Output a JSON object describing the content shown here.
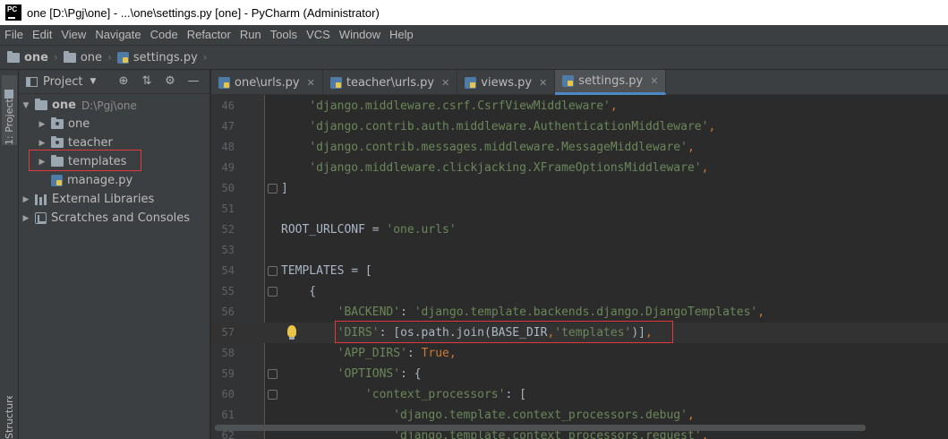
{
  "title": "one [D:\\Pgj\\one] - ...\\one\\settings.py [one] - PyCharm (Administrator)",
  "app_icon_text": "PC",
  "menu": [
    "File",
    "Edit",
    "View",
    "Navigate",
    "Code",
    "Refactor",
    "Run",
    "Tools",
    "VCS",
    "Window",
    "Help"
  ],
  "breadcrumb": [
    "one",
    "one",
    "settings.py"
  ],
  "toolstrip": {
    "project_tab": "1: Project",
    "structure_tab": "Structure"
  },
  "project_panel": {
    "title": "Project",
    "tree": [
      {
        "label": "one",
        "hint": "D:\\Pgj\\one",
        "level": 0,
        "expanded": true,
        "kind": "folder"
      },
      {
        "label": "one",
        "level": 1,
        "expanded": false,
        "kind": "package"
      },
      {
        "label": "teacher",
        "level": 1,
        "expanded": false,
        "kind": "package"
      },
      {
        "label": "templates",
        "level": 1,
        "expanded": false,
        "kind": "folder",
        "highlighted": true
      },
      {
        "label": "manage.py",
        "level": 1,
        "kind": "python"
      },
      {
        "label": "External Libraries",
        "level": 0,
        "expanded": false,
        "kind": "library"
      },
      {
        "label": "Scratches and Consoles",
        "level": 0,
        "expanded": false,
        "kind": "scratch"
      }
    ]
  },
  "tabs": [
    {
      "label": "one\\urls.py",
      "active": false
    },
    {
      "label": "teacher\\urls.py",
      "active": false
    },
    {
      "label": "views.py",
      "active": false
    },
    {
      "label": "settings.py",
      "active": true
    }
  ],
  "code_lines": [
    {
      "num": "46",
      "text": "    'django.middleware.csrf.CsrfViewMiddleware',"
    },
    {
      "num": "47",
      "text": "    'django.contrib.auth.middleware.AuthenticationMiddleware',"
    },
    {
      "num": "48",
      "text": "    'django.contrib.messages.middleware.MessageMiddleware',"
    },
    {
      "num": "49",
      "text": "    'django.middleware.clickjacking.XFrameOptionsMiddleware',"
    },
    {
      "num": "50",
      "text": "]"
    },
    {
      "num": "51",
      "text": ""
    },
    {
      "num": "52",
      "text": "ROOT_URLCONF = 'one.urls'"
    },
    {
      "num": "53",
      "text": ""
    },
    {
      "num": "54",
      "text": "TEMPLATES = ["
    },
    {
      "num": "55",
      "text": "    {"
    },
    {
      "num": "56",
      "text": "        'BACKEND': 'django.template.backends.django.DjangoTemplates',"
    },
    {
      "num": "57",
      "text": "        'DIRS': [os.path.join(BASE_DIR,'templates')],"
    },
    {
      "num": "58",
      "text": "        'APP_DIRS': True,"
    },
    {
      "num": "59",
      "text": "        'OPTIONS': {"
    },
    {
      "num": "60",
      "text": "            'context_processors': ["
    },
    {
      "num": "61",
      "text": "                'django.template.context_processors.debug',"
    },
    {
      "num": "62",
      "text": "                'django.template.context_processors.request',"
    }
  ],
  "colors": {
    "string": "#6a8759",
    "keyword": "#cc7832",
    "code": "#a9b7c6",
    "highlight_box": "#e03a3a",
    "active_tab_underline": "#4a88c7"
  }
}
